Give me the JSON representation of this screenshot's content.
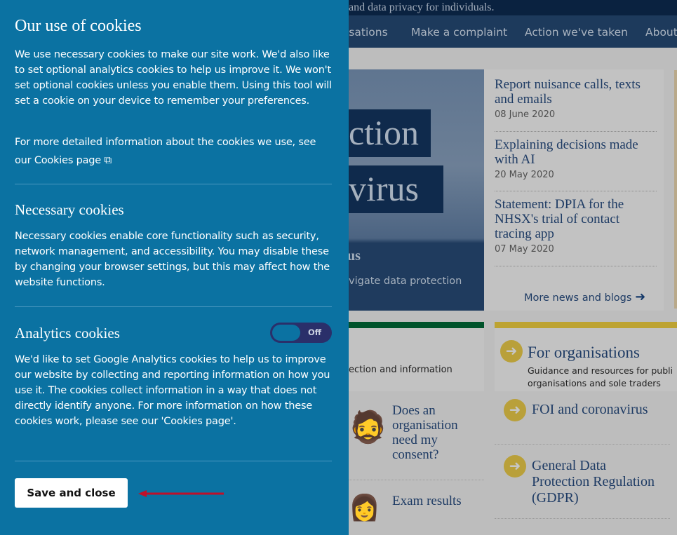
{
  "panel": {
    "title": "Our use of cookies",
    "intro": "We use necessary cookies to make our site work. We'd also like to set optional analytics cookies to help us improve it. We won't set optional cookies unless you enable them. Using this tool will set a cookie on your device to remember your preferences.",
    "more_info": "For more detailed information about the cookies we use, see our Cookies page",
    "necessary": {
      "title": "Necessary cookies",
      "text": "Necessary cookies enable core functionality such as security, network management, and accessibility. You may disable these by changing your browser settings, but this may affect how the website functions."
    },
    "analytics": {
      "title": "Analytics cookies",
      "toggle_label": "Off",
      "toggle_on": false,
      "text": "We'd like to set Google Analytics cookies to help us to improve our website by collecting and reporting information on how you use it. The cookies collect information in a way that does not directly identify anyone. For more information on how these cookies work, please see our 'Cookies page'."
    },
    "save_label": "Save and close",
    "arrow_color": "#c0102a"
  },
  "site": {
    "tagline": "and data privacy for individuals.",
    "nav": [
      "isations",
      "Make a complaint",
      "Action we've taken",
      "About"
    ],
    "hero": {
      "line1": "ction",
      "line2": "virus",
      "sub": "us",
      "desc": "vigate data protection"
    },
    "news": [
      {
        "title": "Report nuisance calls, texts and emails",
        "date": "08 June 2020"
      },
      {
        "title": "Explaining decisions made with AI",
        "date": "20 May 2020"
      },
      {
        "title": "Statement: DPIA for the NHSX's trial of contact tracing app",
        "date": "07 May 2020"
      }
    ],
    "more_news": "More news and blogs",
    "left_card_text": "ection and information",
    "org_card": {
      "title": "For organisations",
      "text": "Guidance and resources for publi organisations and sole traders"
    },
    "left_links": [
      "Does an organisation need my consent?",
      "Exam results"
    ],
    "right_links": [
      "FOI and coronavirus",
      "General Data Protection Regulation (GDPR)"
    ],
    "colors": {
      "green": "#00532b",
      "yellow": "#bda332"
    }
  }
}
